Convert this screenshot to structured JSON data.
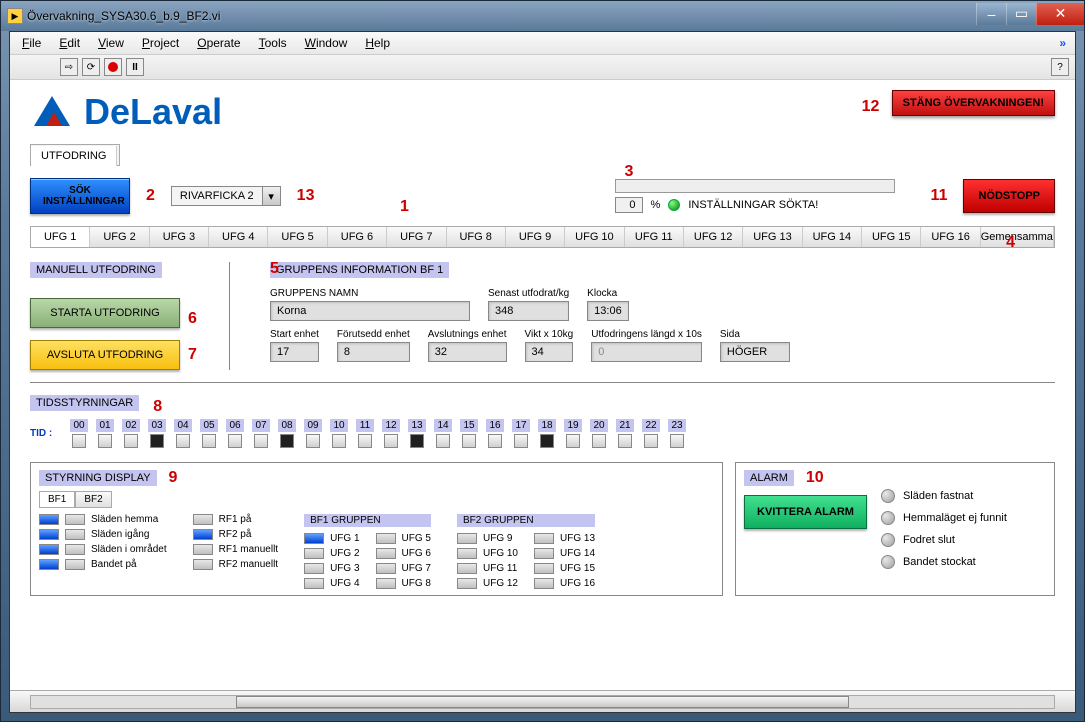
{
  "window": {
    "title": "Övervakning_SYSA30.6_b.9_BF2.vi"
  },
  "menus": [
    "File",
    "Edit",
    "View",
    "Project",
    "Operate",
    "Tools",
    "Window",
    "Help"
  ],
  "logo_text": "DeLaval",
  "btn_stang": "STÄNG ÖVERVAKNINGEN!",
  "tab_main": "UTFODRING",
  "btn_sok": "SÖK INSTÄLLNINGAR",
  "dropdown_value": "RIVARFICKA 2",
  "progress": {
    "pct": "0",
    "pct_sign": "%",
    "status": "INSTÄLLNINGAR SÖKTA!"
  },
  "btn_nodstopp": "NÖDSTOPP",
  "ufg_tabs": [
    "UFG 1",
    "UFG 2",
    "UFG 3",
    "UFG 4",
    "UFG 5",
    "UFG 6",
    "UFG 7",
    "UFG 8",
    "UFG 9",
    "UFG 10",
    "UFG 11",
    "UFG 12",
    "UFG 13",
    "UFG 14",
    "UFG 15",
    "UFG 16",
    "Gemensamma"
  ],
  "manuell": {
    "hdr": "MANUELL UTFODRING",
    "start": "STARTA UTFODRING",
    "avsluta": "AVSLUTA UTFODRING"
  },
  "grp": {
    "hdr": "GRUPPENS INFORMATION BF 1",
    "namn_lab": "GRUPPENS NAMN",
    "namn": "Korna",
    "senast_lab": "Senast utfodrat/kg",
    "senast": "348",
    "klocka_lab": "Klocka",
    "klocka": "13:06",
    "start_enhet_lab": "Start enhet",
    "start_enhet": "17",
    "forut_lab": "Förutsedd enhet",
    "forut": "8",
    "avslut_lab": "Avslutnings enhet",
    "avslut": "32",
    "vikt_lab": "Vikt x 10kg",
    "vikt": "34",
    "utfl_lab": "Utfodringens längd x 10s",
    "utfl": "0",
    "sida_lab": "Sida",
    "sida": "HÖGER"
  },
  "tids": {
    "hdr": "TIDSSTYRNINGAR",
    "tid_label": "TID :",
    "hours": [
      "00",
      "01",
      "02",
      "03",
      "04",
      "05",
      "06",
      "07",
      "08",
      "09",
      "10",
      "11",
      "12",
      "13",
      "14",
      "15",
      "16",
      "17",
      "18",
      "19",
      "20",
      "21",
      "22",
      "23"
    ],
    "dark": [
      3,
      8,
      13,
      18
    ]
  },
  "styrning": {
    "hdr": "STYRNING DISPLAY",
    "bf1": "BF1",
    "bf2": "BF2",
    "col1": [
      {
        "label": "Släden hemma",
        "b1": true,
        "b2": false
      },
      {
        "label": "Släden igång",
        "b1": true,
        "b2": false
      },
      {
        "label": "Släden i området",
        "b1": true,
        "b2": false
      },
      {
        "label": "Bandet på",
        "b1": true,
        "b2": false
      }
    ],
    "col2": [
      {
        "label": "RF1 på",
        "on": false
      },
      {
        "label": "RF2 på",
        "on": true
      },
      {
        "label": "RF1 manuellt",
        "on": false
      },
      {
        "label": "RF2 manuellt",
        "on": false
      }
    ],
    "bf1g_hdr": "BF1 GRUPPEN",
    "bf2g_hdr": "BF2 GRUPPEN",
    "bf1g_a": [
      {
        "l": "UFG 1",
        "on": true
      },
      {
        "l": "UFG 2",
        "on": false
      },
      {
        "l": "UFG 3",
        "on": false
      },
      {
        "l": "UFG 4",
        "on": false
      }
    ],
    "bf1g_b": [
      {
        "l": "UFG 5",
        "on": false
      },
      {
        "l": "UFG 6",
        "on": false
      },
      {
        "l": "UFG 7",
        "on": false
      },
      {
        "l": "UFG 8",
        "on": false
      }
    ],
    "bf2g_a": [
      {
        "l": "UFG 9",
        "on": false
      },
      {
        "l": "UFG 10",
        "on": false
      },
      {
        "l": "UFG 11",
        "on": false
      },
      {
        "l": "UFG 12",
        "on": false
      }
    ],
    "bf2g_b": [
      {
        "l": "UFG 13",
        "on": false
      },
      {
        "l": "UFG 14",
        "on": false
      },
      {
        "l": "UFG 15",
        "on": false
      },
      {
        "l": "UFG 16",
        "on": false
      }
    ]
  },
  "alarm": {
    "hdr": "ALARM",
    "kvittera": "KVITTERA ALARM",
    "items": [
      "Släden fastnat",
      "Hemmaläget ej funnit",
      "Fodret slut",
      "Bandet stockat"
    ]
  },
  "annotations": {
    "a1": "1",
    "a2": "2",
    "a3": "3",
    "a4": "4",
    "a5": "5",
    "a6": "6",
    "a7": "7",
    "a8": "8",
    "a9": "9",
    "a10": "10",
    "a11": "11",
    "a12": "12",
    "a13": "13"
  }
}
